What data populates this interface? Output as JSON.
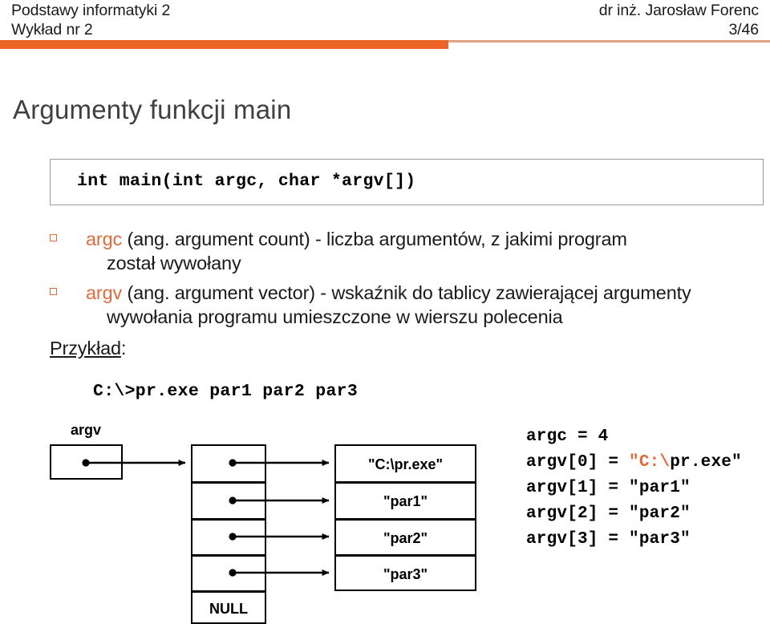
{
  "header": {
    "course": "Podstawy informatyki 2",
    "lecture": "Wykład nr 2",
    "author": "dr inż. Jarosław Forenc",
    "page": "3/46",
    "accent_thick": "#ec6426",
    "accent_thin": "#dda288"
  },
  "slide": {
    "title": "Argumenty funkcji main",
    "signature": "int main(int argc, char *argv[])",
    "example_label": "Przykład",
    "example_label_suffix": ":",
    "command_line": "C:\\>pr.exe par1 par2 par3",
    "accent_color": "#dd6b3d"
  },
  "bullets": [
    {
      "keyword": "argc",
      "line1": " (ang. argument count) - liczba argumentów, z jakimi program",
      "line2": "został wywołany"
    },
    {
      "keyword": "argv",
      "line1": " (ang. argument vector) - wskaźnik do tablicy zawierającej argumenty",
      "line2": "wywołania programu umieszczone w wierszu polecenia"
    }
  ],
  "diagram": {
    "root_label": "argv",
    "null_label": "NULL",
    "strings": [
      "\"C:\\pr.exe\"",
      "\"par1\"",
      "\"par2\"",
      "\"par3\""
    ]
  },
  "listing": {
    "argc_line": "argc = 4",
    "rows": [
      {
        "lhs": "argv[0] = ",
        "orange": "\"C:\\",
        "rest": "pr.exe\""
      },
      {
        "lhs": "argv[1] = ",
        "orange": "",
        "rest": "\"par1\""
      },
      {
        "lhs": "argv[2] = ",
        "orange": "",
        "rest": "\"par2\""
      },
      {
        "lhs": "argv[3] = ",
        "orange": "",
        "rest": "\"par3\""
      }
    ]
  }
}
